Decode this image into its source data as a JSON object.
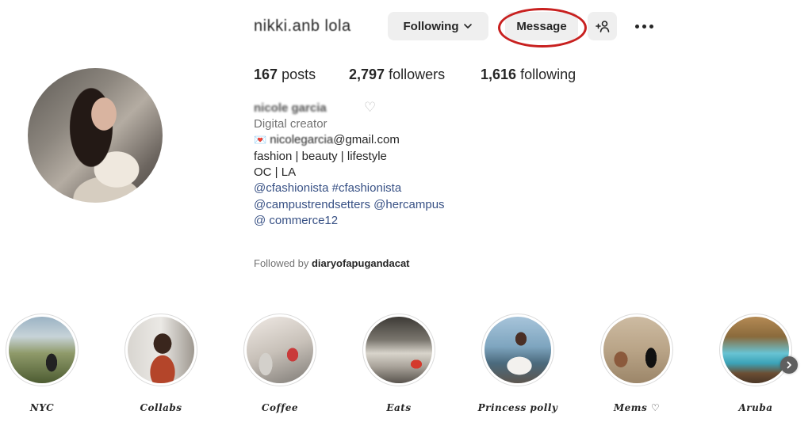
{
  "header": {
    "username": "nikki.anb lola",
    "following_label": "Following",
    "message_label": "Message"
  },
  "stats": {
    "posts_count": "167",
    "posts_label": "posts",
    "followers_count": "2,797",
    "followers_label": "followers",
    "following_count": "1,616",
    "following_label": "following"
  },
  "bio": {
    "full_name": "nicole garcia",
    "category": "Digital creator",
    "email_emoji": "💌",
    "email_hidden": "nicolegarcia",
    "email_visible": "@gmail.com",
    "line3": "fashion | beauty | lifestyle",
    "line4": "OC | LA",
    "line5": "@cfashionista #cfashionista",
    "line6": "@campustrendsetters @hercampus",
    "line7": "@ commerce12"
  },
  "followed_by": {
    "prefix": "Followed by ",
    "name": "diaryofapugandacat"
  },
  "highlights": [
    {
      "label": "NYC"
    },
    {
      "label": "Collabs"
    },
    {
      "label": "Coffee"
    },
    {
      "label": "Eats"
    },
    {
      "label": "Princess polly"
    },
    {
      "label": "Mems ♡"
    },
    {
      "label": "Aruba"
    }
  ],
  "colors": {
    "link": "#385185",
    "button_bg": "#efefef",
    "annotation_circle": "#c8201f",
    "muted": "#737373"
  },
  "icons": [
    "chevron-down-icon",
    "add-user-icon",
    "more-options-icon",
    "heart-outline-icon",
    "chevron-right-icon"
  ]
}
